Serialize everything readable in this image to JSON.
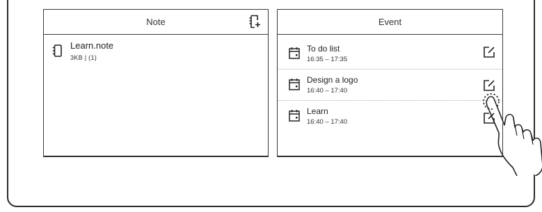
{
  "note_panel": {
    "header": "Note",
    "items": [
      {
        "title": "Learn.note",
        "meta": "3KB  |  (1)"
      }
    ]
  },
  "event_panel": {
    "header": "Event",
    "items": [
      {
        "title": "To do list",
        "time": "16:35 – 17:35"
      },
      {
        "title": "Design a logo",
        "time": "16:40 – 17:40"
      },
      {
        "title": "Learn",
        "time": "16:40 – 17:40"
      }
    ]
  },
  "icons": {
    "note_header": "new-note-icon",
    "note_item": "notebook-icon",
    "event_item": "calendar-icon",
    "event_action": "edit-icon",
    "gesture": "tap-hand-icon"
  }
}
